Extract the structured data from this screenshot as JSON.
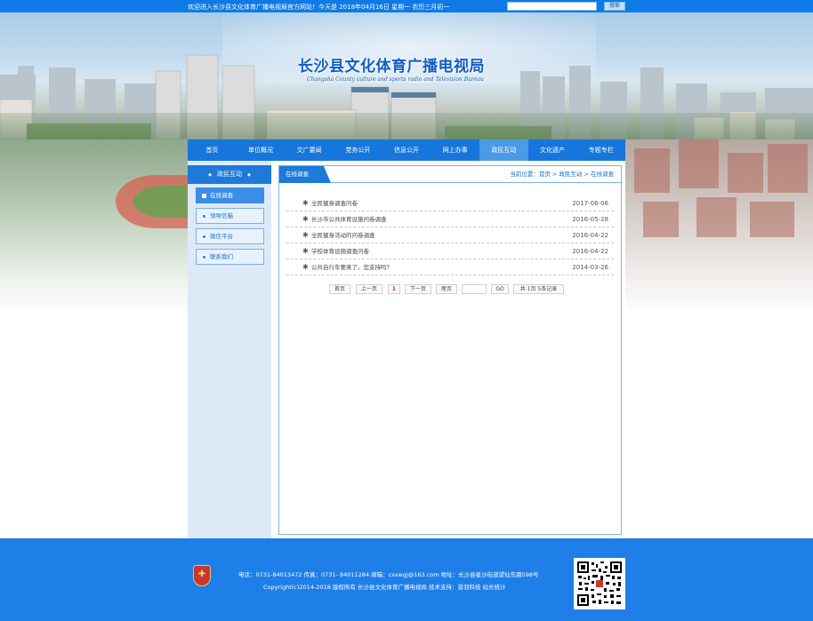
{
  "topbar": {
    "welcome": "欢迎进入长沙县文化体育广播电视局官方网站！",
    "date": "今天是 2018年04月16日 星期一 农历三月初一",
    "search_placeholder": "",
    "search_button": "搜索"
  },
  "banner": {
    "title": "长沙县文化体育广播电视局",
    "subtitle": "Changsha County culture and sports radio and Television Bureau"
  },
  "nav": {
    "items": [
      "首页",
      "单位概况",
      "文广要闻",
      "党务公开",
      "信息公开",
      "网上办事",
      "政民互动",
      "文化遗产",
      "专题专栏"
    ],
    "active_index": 6
  },
  "sidebar": {
    "title": "政民互动",
    "items": [
      "在线调查",
      "领导信箱",
      "微信平台",
      "联系我们"
    ],
    "active_index": 0
  },
  "content": {
    "tab": "在线调查",
    "breadcrumb": "当前位置：首页 > 政民互动 > 在线调查",
    "list": [
      {
        "title": "全民健身调查问卷",
        "date": "2017-06-06"
      },
      {
        "title": "长沙市公共体育设施问卷调查",
        "date": "2016-05-28"
      },
      {
        "title": "全民健身活动的问卷调查",
        "date": "2016-04-22"
      },
      {
        "title": "学校体育设施调查问卷",
        "date": "2016-04-22"
      },
      {
        "title": "公共自行车要来了，您支持吗？",
        "date": "2014-03-26"
      }
    ]
  },
  "pager": {
    "first": "首页",
    "prev": "上一页",
    "current": "1",
    "next": "下一页",
    "last": "尾页",
    "go": "GO",
    "summary": "共 1页 5条记录"
  },
  "footer": {
    "contact": "电话：0731-84013472 传真：0731- 84011284 邮箱：csxwgj@163.com 地址：长沙县星沙街道望仙东路598号",
    "copyright": "Copyright(c)2014-2018 版权所有 长沙县文化体育广播电视局   技术支持：普羽科技   站长统计"
  },
  "colors": {
    "primary": "#1776db",
    "footer": "#1e7fe8",
    "sidebar_bg": "#dde9f7"
  }
}
